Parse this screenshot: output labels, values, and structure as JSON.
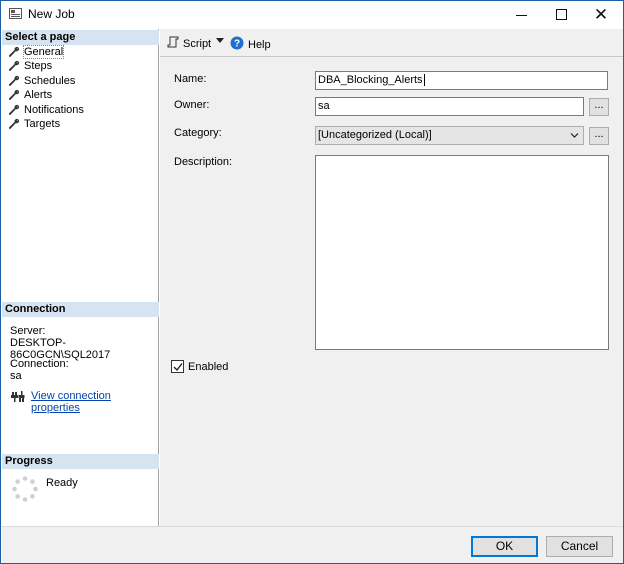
{
  "window": {
    "title": "New Job"
  },
  "left": {
    "select_page_header": "Select a page",
    "pages": [
      {
        "label": "General"
      },
      {
        "label": "Steps"
      },
      {
        "label": "Schedules"
      },
      {
        "label": "Alerts"
      },
      {
        "label": "Notifications"
      },
      {
        "label": "Targets"
      }
    ],
    "connection_header": "Connection",
    "server_label": "Server:",
    "server_value": "DESKTOP-86C0GCN\\SQL2017",
    "connection_label": "Connection:",
    "connection_value": "sa",
    "view_props_link": "View connection properties",
    "progress_header": "Progress",
    "progress_status": "Ready"
  },
  "toolbar": {
    "script_label": "Script",
    "help_label": "Help"
  },
  "form": {
    "name_label": "Name:",
    "name_value": "DBA_Blocking_Alerts",
    "owner_label": "Owner:",
    "owner_value": "sa",
    "category_label": "Category:",
    "category_value": "[Uncategorized (Local)]",
    "description_label": "Description:",
    "description_value": "",
    "enabled_label": "Enabled",
    "enabled_checked": true,
    "ellipsis": "..."
  },
  "buttons": {
    "ok": "OK",
    "cancel": "Cancel"
  },
  "colors": {
    "section_header_bg": "#d6e4f1",
    "link": "#0645ad",
    "default_button_border": "#0078d7"
  }
}
